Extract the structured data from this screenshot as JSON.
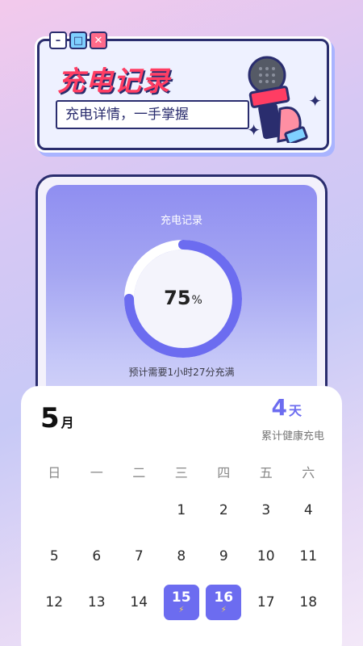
{
  "banner": {
    "title": "充电记录",
    "subtitle": "充电详情，一手掌握",
    "window_buttons": [
      "minimize",
      "maximize",
      "close"
    ]
  },
  "card": {
    "title": "充电记录",
    "percent_value": "75",
    "percent_unit": "%",
    "progress": 0.75,
    "eta": "预计需要1小时27分充满"
  },
  "calendar": {
    "month_value": "5",
    "month_unit": "月",
    "days_value": "4",
    "days_unit": "天",
    "days_label": "累计健康充电",
    "weekdays": [
      "日",
      "一",
      "二",
      "三",
      "四",
      "五",
      "六"
    ],
    "rows": [
      [
        "",
        "",
        "",
        "1",
        "2",
        "3",
        "4"
      ],
      [
        "5",
        "6",
        "7",
        "8",
        "9",
        "10",
        "11"
      ],
      [
        "12",
        "13",
        "14",
        "15",
        "16",
        "17",
        "18"
      ]
    ],
    "selected_days": [
      "15",
      "16"
    ],
    "accent_color": "#6c6cf0"
  }
}
